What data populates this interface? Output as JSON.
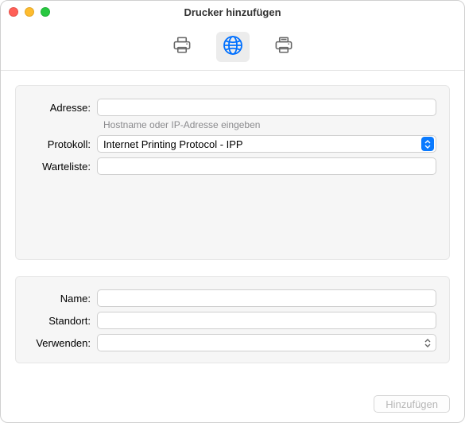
{
  "window": {
    "title": "Drucker hinzufügen"
  },
  "toolbar": {
    "items": [
      {
        "name": "default-printer-icon",
        "selected": false
      },
      {
        "name": "ip-globe-icon",
        "selected": true
      },
      {
        "name": "windows-printer-icon",
        "selected": false
      }
    ]
  },
  "top": {
    "address_label": "Adresse:",
    "address_value": "",
    "address_hint": "Hostname oder IP-Adresse eingeben",
    "protocol_label": "Protokoll:",
    "protocol_value": "Internet Printing Protocol - IPP",
    "queue_label": "Warteliste:",
    "queue_value": ""
  },
  "bottom": {
    "name_label": "Name:",
    "name_value": "",
    "location_label": "Standort:",
    "location_value": "",
    "use_label": "Verwenden:",
    "use_value": ""
  },
  "footer": {
    "add_label": "Hinzufügen",
    "add_enabled": false
  }
}
